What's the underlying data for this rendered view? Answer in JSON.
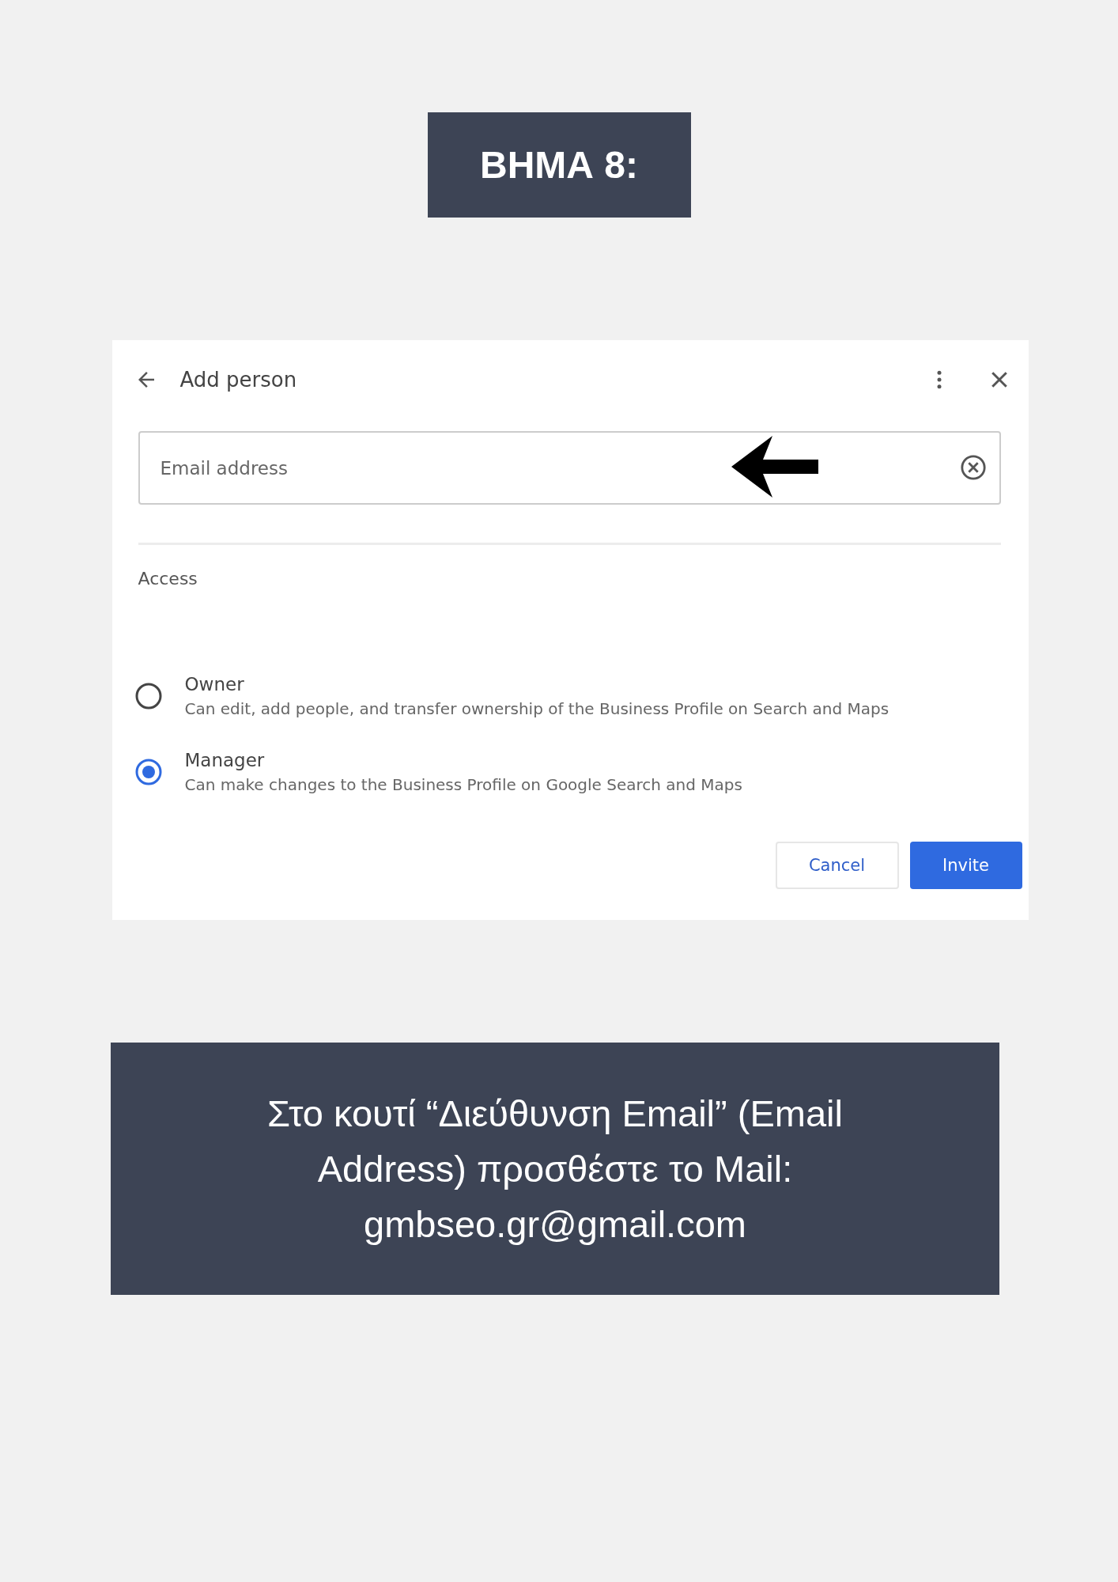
{
  "step_title": "ΒΗΜΑ 8:",
  "dialog": {
    "title": "Add person",
    "email_field": {
      "placeholder": "Email address"
    },
    "section_label": "Access",
    "roles": [
      {
        "label": "Owner",
        "description": "Can edit, add people, and transfer ownership of the Business Profile on Search and Maps",
        "selected": false
      },
      {
        "label": "Manager",
        "description": "Can make changes to the Business Profile on Google Search and Maps",
        "selected": true
      }
    ],
    "buttons": [
      {
        "label": "Cancel",
        "kind": "secondary"
      },
      {
        "label": "Invite",
        "kind": "primary"
      }
    ]
  },
  "instruction": "Στο κουτί “Διεύθυνση Email” (Email Address) προσθέστε το Mail: gmbseo.gr@gmail.com"
}
